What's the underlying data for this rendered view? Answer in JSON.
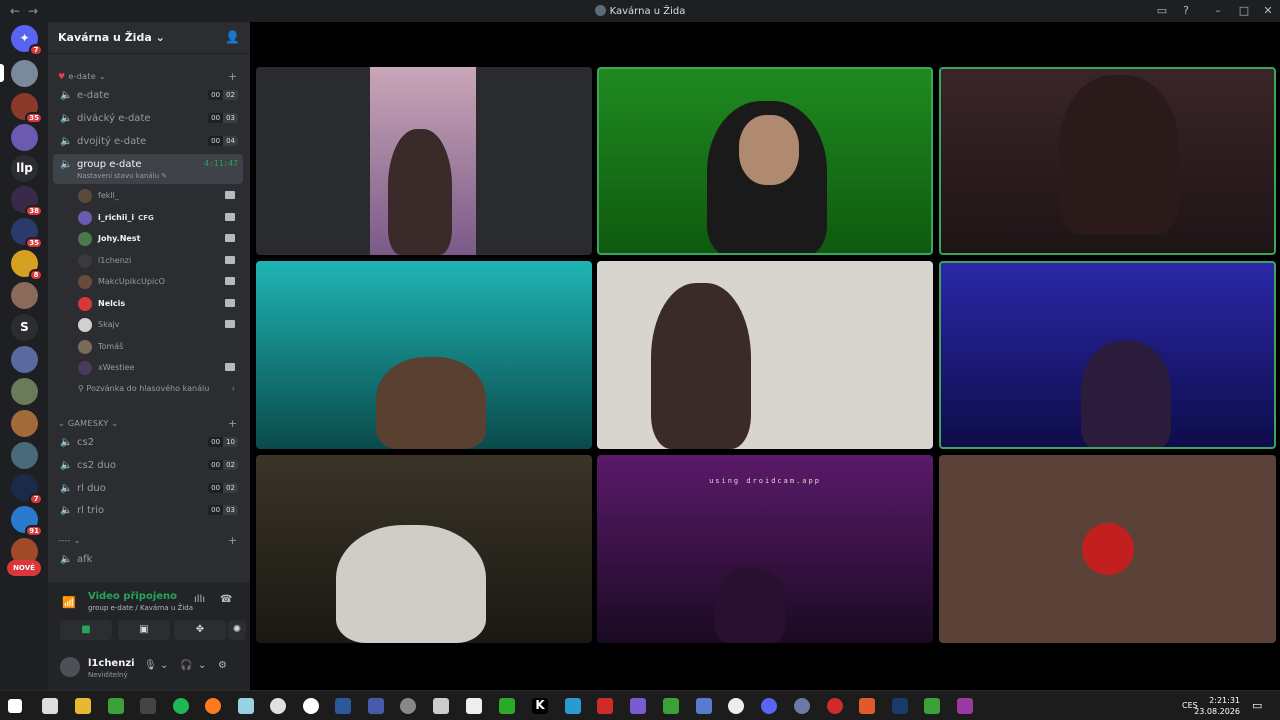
{
  "window": {
    "title": "Kavárna u Žida"
  },
  "server_name": "Kavárna u Žida",
  "server_badges": [
    "7",
    "35",
    "38",
    "35",
    "8",
    "7",
    "91",
    "NOVÉ"
  ],
  "server_letters": {
    "llp": "llp",
    "s": "S"
  },
  "categories": {
    "edate": {
      "label": "e-date"
    },
    "gamesky": {
      "label": "GAMESKY"
    },
    "dashes": {
      "label": "----"
    }
  },
  "channels": [
    {
      "label": "e-date",
      "left": "00",
      "right": "02"
    },
    {
      "label": "divácký e-date",
      "left": "00",
      "right": "03"
    },
    {
      "label": "dvojitý e-date",
      "left": "00",
      "right": "04"
    }
  ],
  "active_channel": {
    "label": "group e-date",
    "timer": "4:11:47",
    "status": "Nastavení stavu kanálu"
  },
  "members": [
    {
      "name": "fekll_",
      "bold": false,
      "camera": true
    },
    {
      "name": "i_richii_i",
      "bold": true,
      "camera": true,
      "tag": "CFG"
    },
    {
      "name": "Johy.Nest",
      "bold": true,
      "camera": true
    },
    {
      "name": "l1chenzi",
      "bold": false,
      "camera": true
    },
    {
      "name": "MakcUpikcUpicO",
      "bold": false,
      "camera": true
    },
    {
      "name": "Nelcis",
      "bold": true,
      "camera": true
    },
    {
      "name": "Skajv",
      "bold": false,
      "camera": true
    },
    {
      "name": "Tomáš",
      "bold": false,
      "camera": false
    },
    {
      "name": "xWestiee",
      "bold": false,
      "camera": true
    }
  ],
  "invite": "Pozvánka do hlasového kanálu",
  "gamesky_channels": [
    {
      "label": "cs2",
      "left": "00",
      "right": "10"
    },
    {
      "label": "cs2 duo",
      "left": "00",
      "right": "02"
    },
    {
      "label": "rl duo",
      "left": "00",
      "right": "02"
    },
    {
      "label": "rl trio",
      "left": "00",
      "right": "03"
    }
  ],
  "afk_channel": {
    "label": "afk"
  },
  "voice": {
    "status": "Video připojeno",
    "location": "group e-date / Kavárna u Žida"
  },
  "user": {
    "name": "l1chenzi",
    "status": "Neviditelný"
  },
  "video_overlay": "using droidcam.app",
  "tray": {
    "lang": "CES",
    "time": "2:21:31",
    "date": "23.08.2026"
  }
}
